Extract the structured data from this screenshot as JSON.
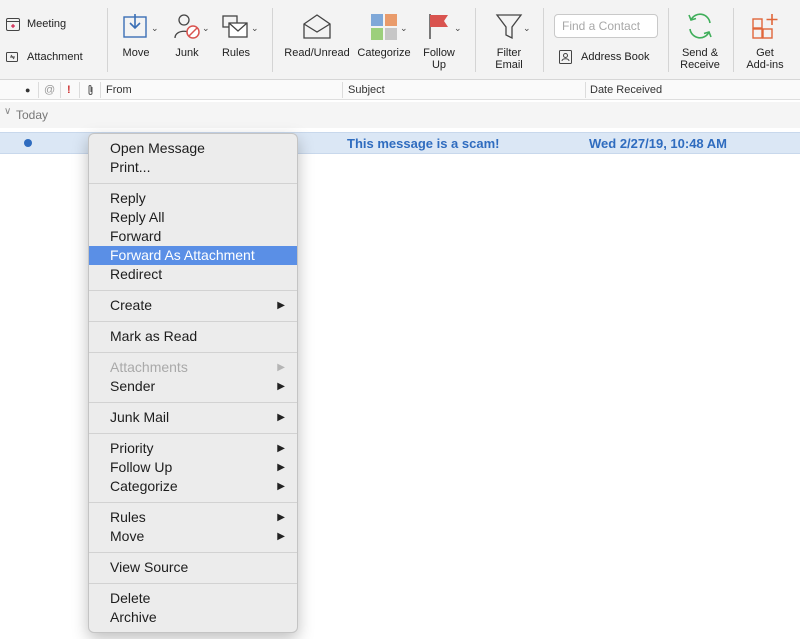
{
  "ribbon": {
    "meeting": "Meeting",
    "attachment": "Attachment",
    "move": "Move",
    "junk": "Junk",
    "rules": "Rules",
    "read_unread": "Read/Unread",
    "categorize": "Categorize",
    "follow_up_1": "Follow",
    "follow_up_2": "Up",
    "filter_email_1": "Filter",
    "filter_email_2": "Email",
    "find_contact_placeholder": "Find a Contact",
    "address_book": "Address Book",
    "send_receive_1": "Send &",
    "send_receive_2": "Receive",
    "get_addins_1": "Get",
    "get_addins_2": "Add-ins",
    "colors": {
      "accent_blue": "#2f6cbf",
      "flag_red": "#d9534f",
      "green": "#3fae5a",
      "orange": "#e0663a"
    }
  },
  "columns": {
    "from": "From",
    "subject": "Subject",
    "date_received": "Date Received"
  },
  "group": {
    "label": "Today"
  },
  "message": {
    "subject": "This message is a scam!",
    "date": "Wed 2/27/19, 10:48 AM"
  },
  "context_menu": {
    "open_message": "Open Message",
    "print": "Print...",
    "reply": "Reply",
    "reply_all": "Reply All",
    "forward": "Forward",
    "forward_as_attachment": "Forward As Attachment",
    "redirect": "Redirect",
    "create": "Create",
    "mark_as_read": "Mark as Read",
    "attachments": "Attachments",
    "sender": "Sender",
    "junk_mail": "Junk Mail",
    "priority": "Priority",
    "follow_up": "Follow Up",
    "categorize": "Categorize",
    "rules": "Rules",
    "move": "Move",
    "view_source": "View Source",
    "delete": "Delete",
    "archive": "Archive",
    "submenu_arrow": "▶"
  }
}
